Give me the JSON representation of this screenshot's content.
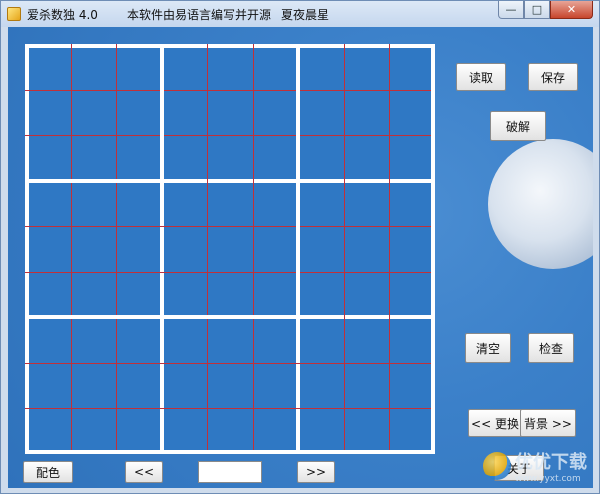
{
  "window": {
    "title_parts": [
      "爱杀数独 4.0",
      "本软件由易语言编写并开源",
      "夏夜晨星"
    ],
    "controls": {
      "minimize": "—",
      "maximize": "□",
      "close": "✕"
    }
  },
  "buttons": {
    "read": "读取",
    "save": "保存",
    "solve": "破解",
    "clear": "清空",
    "check": "检查",
    "bg_prev": "<< 更换",
    "bg_next": "背景 >>",
    "about": "关于",
    "color": "配色",
    "nav_prev": "<<",
    "nav_next": ">>"
  },
  "watermark": {
    "text": "优优下载",
    "url": "www.yyxt.com"
  },
  "icons": [
    "app-icon",
    "moon-image",
    "watermark-logo"
  ]
}
